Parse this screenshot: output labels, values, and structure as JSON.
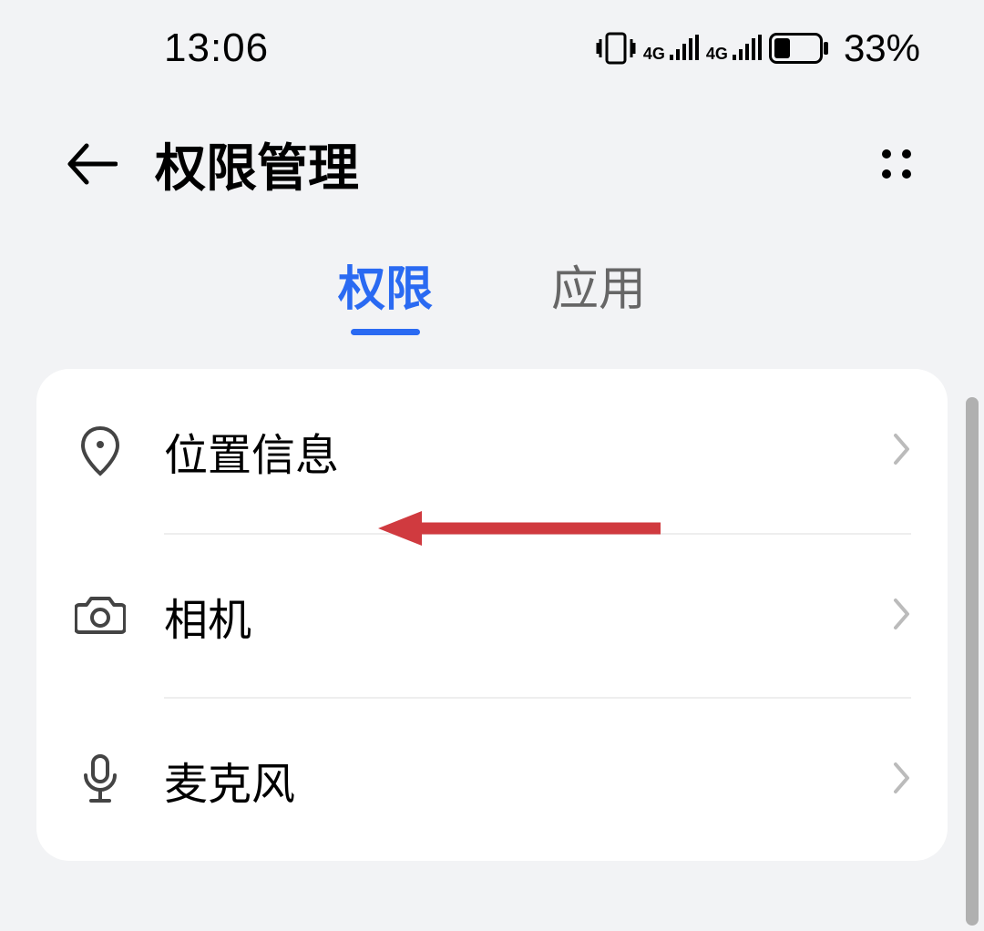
{
  "status_bar": {
    "time": "13:06",
    "battery_pct": "33%"
  },
  "header": {
    "title": "权限管理"
  },
  "tabs": {
    "items": [
      {
        "label": "权限",
        "active": true
      },
      {
        "label": "应用",
        "active": false
      }
    ]
  },
  "permissions": [
    {
      "label": "位置信息",
      "icon": "location"
    },
    {
      "label": "相机",
      "icon": "camera"
    },
    {
      "label": "麦克风",
      "icon": "microphone"
    }
  ],
  "annotation": {
    "arrow_color": "#d03a3f",
    "target": "位置信息"
  }
}
